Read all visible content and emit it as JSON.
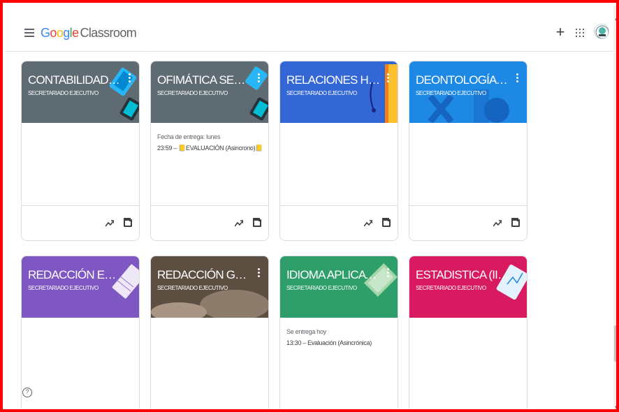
{
  "app": {
    "brand_letters": [
      "G",
      "o",
      "o",
      "g",
      "l",
      "e"
    ],
    "brand_suffix": "Classroom"
  },
  "header_icons": [
    "menu-icon",
    "plus-icon",
    "apps-icon",
    "account-avatar"
  ],
  "cards": [
    {
      "title": "CONTABILIDAD (IV S...",
      "section": "SECRETARIADO EJECUTIVO",
      "color": "#5f6b73",
      "due_label": "",
      "due_item": "",
      "has_footer": true
    },
    {
      "title": "OFIMÁTICA SECRETA...",
      "section": "SECRETARIADO EJECUTIVO",
      "color": "#5f6b73",
      "due_label": "Fecha de entrega: lunes",
      "due_item": "23:59 – 📒EVALUACIÓN (Asincrono)📒",
      "has_footer": true
    },
    {
      "title": "RELACIONES HUMA...",
      "section": "SECRETARIADO EJECUTIVO",
      "color": "#3367d6",
      "due_label": "",
      "due_item": "",
      "has_footer": true
    },
    {
      "title": "DEONTOLOGÍA SEC...",
      "section": "SECRETARIADO EJECUTIVO",
      "color": "#1e88e5",
      "due_label": "",
      "due_item": "",
      "has_footer": true
    },
    {
      "title": "REDACCIÓN EMPRES...",
      "section": "SECRETARIADO EJECUTIVO",
      "color": "#7e57c2",
      "due_label": "",
      "due_item": "",
      "has_footer": false
    },
    {
      "title": "REDACCIÓN GENER...",
      "section": "SECRETARIADO EJECUTIVO",
      "color": "#6d5a4c",
      "due_label": "",
      "due_item": "",
      "has_footer": false
    },
    {
      "title": "IDIOMA APLICATIVO ...",
      "section": "SECRETARIADO EJECUTIVO",
      "color": "#2e9e6b",
      "due_label": "Se entrega hoy",
      "due_item": "13:30 – Evaluación (Asincrónica)",
      "has_footer": false
    },
    {
      "title": "ESTADISTICA (II SEM...",
      "section": "SECRETARIADO EJECUTIVO",
      "color": "#d81b60",
      "due_label": "",
      "due_item": "",
      "has_footer": false
    }
  ],
  "card_footer_icons": [
    "trending-icon",
    "folder-icon"
  ],
  "help": {
    "symbol": "?"
  }
}
